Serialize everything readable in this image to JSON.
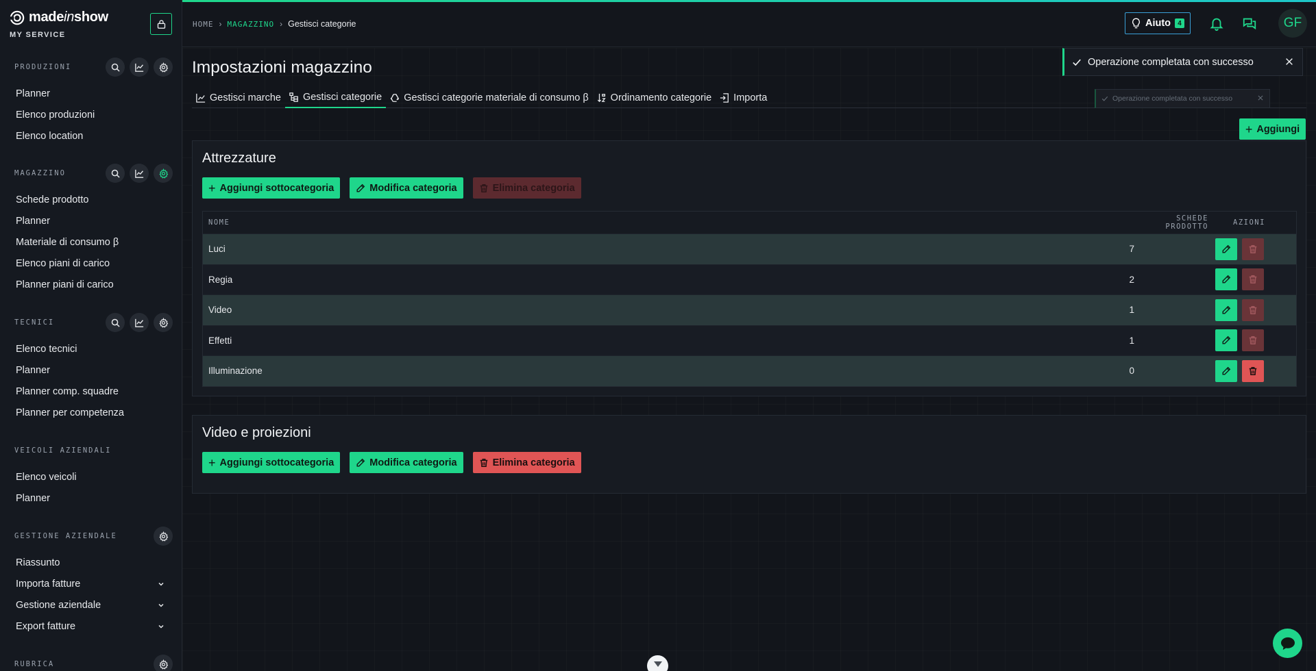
{
  "brand": {
    "name_prefix": "made",
    "name_italic": "in",
    "name_suffix": "show",
    "subtitle": "MY SERVICE"
  },
  "sidebar": {
    "sections": [
      {
        "title": "PRODUZIONI",
        "items": [
          "Planner",
          "Elenco produzioni",
          "Elenco location"
        ]
      },
      {
        "title": "MAGAZZINO",
        "items": [
          "Schede prodotto",
          "Planner",
          "Materiale di consumo β",
          "Elenco piani di carico",
          "Planner piani di carico"
        ]
      },
      {
        "title": "TECNICI",
        "items": [
          "Elenco tecnici",
          "Planner",
          "Planner comp. squadre",
          "Planner per competenza"
        ]
      },
      {
        "title": "VEICOLI AZIENDALI",
        "items": [
          "Elenco veicoli",
          "Planner"
        ]
      },
      {
        "title": "GESTIONE AZIENDALE",
        "items": [
          "Riassunto",
          "Importa fatture",
          "Gestione aziendale",
          "Export fatture"
        ]
      },
      {
        "title": "RUBRICA",
        "items": []
      }
    ]
  },
  "header": {
    "breadcrumb": {
      "home": "HOME",
      "section": "MAGAZZINO",
      "current": "Gestisci categorie"
    },
    "help_label": "Aiuto",
    "help_badge": "4",
    "avatar_initials": "GF"
  },
  "main": {
    "title": "Impostazioni magazzino",
    "tabs": [
      {
        "label": "Gestisci marche",
        "icon": "chart-icon"
      },
      {
        "label": "Gestisci categorie",
        "icon": "hierarchy-icon",
        "active": true
      },
      {
        "label": "Gestisci categorie materiale di consumo β",
        "icon": "recycle-icon"
      },
      {
        "label": "Ordinamento categorie",
        "icon": "sort-icon"
      },
      {
        "label": "Importa",
        "icon": "import-icon"
      }
    ],
    "add_label": "Aggiungi",
    "categories": [
      {
        "title": "Attrezzature",
        "add_sub_label": "Aggiungi sottocategoria",
        "edit_label": "Modifica categoria",
        "delete_label": "Elimina categoria",
        "columns": {
          "name": "NOME",
          "count": "SCHEDE PRODOTTO",
          "actions": "AZIONI"
        },
        "rows": [
          {
            "name": "Luci",
            "count": "7"
          },
          {
            "name": "Regia",
            "count": "2"
          },
          {
            "name": "Video",
            "count": "1"
          },
          {
            "name": "Effetti",
            "count": "1"
          },
          {
            "name": "Illuminazione",
            "count": "0"
          }
        ]
      },
      {
        "title": "Video e proiezioni",
        "add_sub_label": "Aggiungi sottocategoria",
        "edit_label": "Modifica categoria",
        "delete_label": "Elimina categoria"
      }
    ]
  },
  "toast": {
    "message": "Operazione completata con successo",
    "ghost_message": "Operazione completata con successo"
  },
  "colors": {
    "accent": "#1fd68b",
    "danger": "#e05555",
    "help_border": "#3aa0d8"
  }
}
